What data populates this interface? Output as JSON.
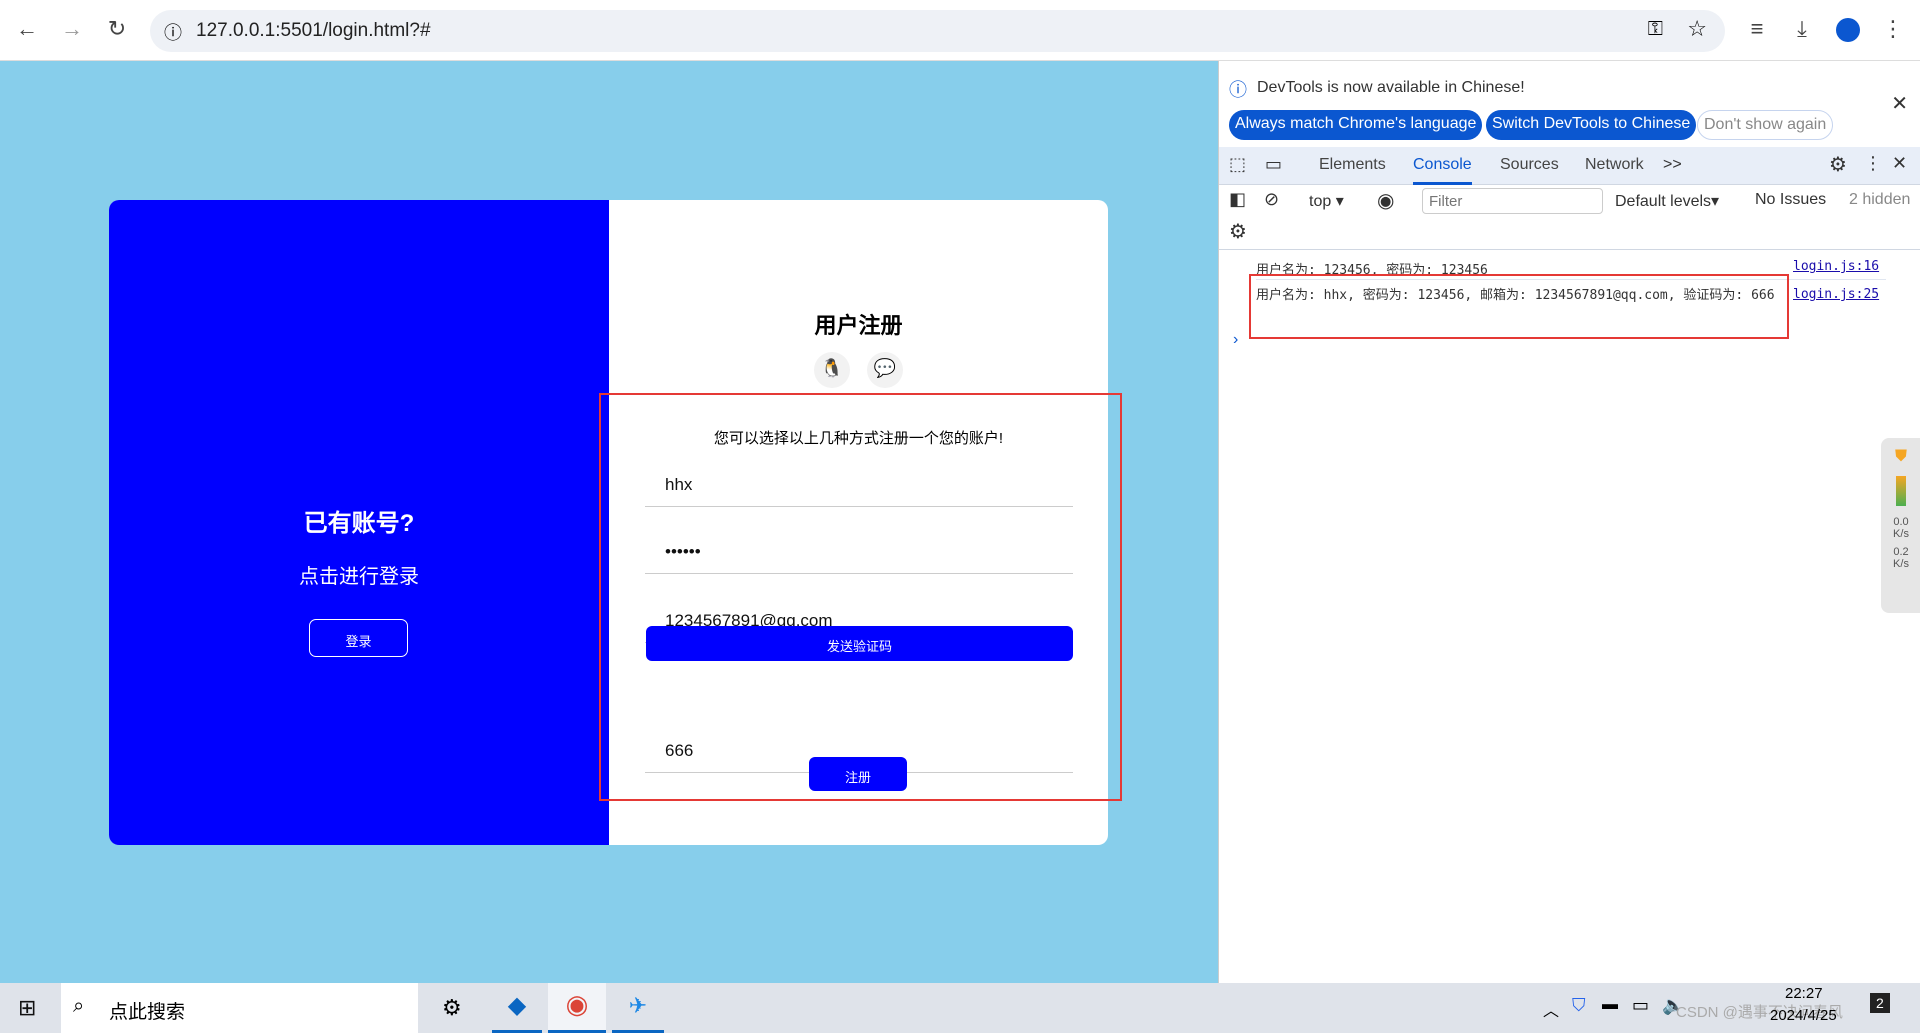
{
  "browser": {
    "url": "127.0.0.1:5501/login.html?#",
    "icons": [
      "back-icon",
      "forward-icon",
      "reload-icon",
      "info-icon",
      "key-icon",
      "star-icon",
      "media-icon",
      "download-icon",
      "profile-icon",
      "menu-icon"
    ]
  },
  "left_panel": {
    "title": "已有账号?",
    "subtitle": "点击进行登录",
    "login_button": "登录"
  },
  "form": {
    "title": "用户注册",
    "social_icons": [
      "qq-icon",
      "wechat-icon"
    ],
    "hint": "您可以选择以上几种方式注册一个您的账户!",
    "username": "hhx",
    "password": "••••••",
    "email": "1234567891@qq.com",
    "send_code_button": "发送验证码",
    "code": "666",
    "register_button": "注册"
  },
  "devtools": {
    "notice": "DevTools is now available in Chinese!",
    "btn_match": "Always match Chrome's language",
    "btn_switch": "Switch DevTools to Chinese",
    "btn_dont": "Don't show again",
    "tabs": [
      "Elements",
      "Console",
      "Sources",
      "Network"
    ],
    "active_tab": "Console",
    "more": ">>",
    "context": "top",
    "filter_placeholder": "Filter",
    "levels": "Default levels",
    "issues": "No Issues",
    "hidden": "2 hidden",
    "logs": [
      {
        "text": "用户名为: 123456, 密码为: 123456",
        "source": "login.js:16"
      },
      {
        "text": "用户名为: hhx, 密码为: 123456, 邮箱为: 1234567891@qq.com, 验证码为: 666",
        "source": "login.js:25"
      }
    ]
  },
  "widget": {
    "up": "0.0",
    "down": "0.2",
    "unit": "K/s"
  },
  "taskbar": {
    "search": "点此搜索",
    "time": "22:27",
    "date": "2024/4/25",
    "watermark": "CSDN @遇事不决问春风",
    "notifications": "2"
  },
  "colors": {
    "page_bg": "#87ceeb",
    "accent": "#0000ff",
    "highlight": "#e53935"
  }
}
